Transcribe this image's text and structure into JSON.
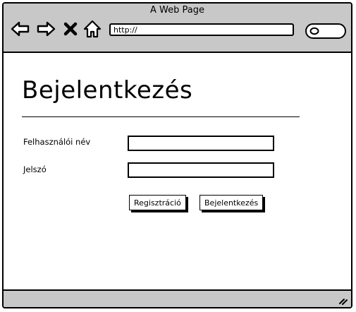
{
  "browser": {
    "title": "A Web Page",
    "url": "http://",
    "icons": [
      "back-arrow-icon",
      "forward-arrow-icon",
      "close-icon",
      "home-icon",
      "search-icon",
      "resize-grip-icon"
    ]
  },
  "login": {
    "heading": "Bejelentkezés",
    "username_label": "Felhasználói név",
    "password_label": "Jelszó",
    "username_value": "",
    "password_value": "",
    "register_button": "Regisztráció",
    "login_button": "Bejelentkezés"
  }
}
